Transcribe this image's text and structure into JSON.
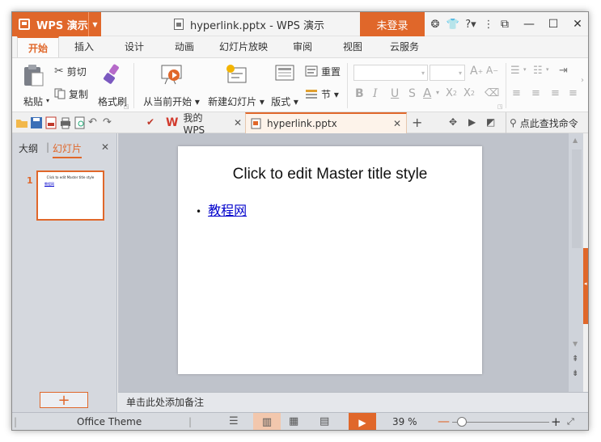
{
  "window": {
    "app_name": "WPS 演示",
    "doc_title": "hyperlink.pptx - WPS 演示",
    "login_label": "未登录"
  },
  "menu_tabs": [
    "开始",
    "插入",
    "设计",
    "动画",
    "幻灯片放映",
    "审阅",
    "视图",
    "云服务"
  ],
  "ribbon": {
    "paste": "粘贴",
    "cut": "剪切",
    "copy": "复制",
    "format_painter": "格式刷",
    "play_from_current": "从当前开始",
    "new_slide": "新建幻灯片",
    "layout": "版式",
    "reset": "重置",
    "section": "节",
    "bold": "B",
    "italic": "I",
    "underline": "U",
    "strike": "S",
    "font_color": "A"
  },
  "quickbar": {
    "doc_tabs": [
      {
        "label": "我的WPS",
        "active": false
      },
      {
        "label": "hyperlink.pptx",
        "active": true
      }
    ],
    "find_command": "点此查找命令"
  },
  "left_panel": {
    "tab_outline": "大纲",
    "tab_slides": "幻灯片",
    "slide_number": "1",
    "add_slide": "+"
  },
  "slide": {
    "title": "Click to edit Master title style",
    "bullet": "•",
    "link_text": "教程网"
  },
  "notes_placeholder": "单击此处添加备注",
  "status": {
    "theme": "Office Theme",
    "zoom": "39 %"
  },
  "colors": {
    "accent": "#e0672a",
    "link": "#0000cc"
  }
}
